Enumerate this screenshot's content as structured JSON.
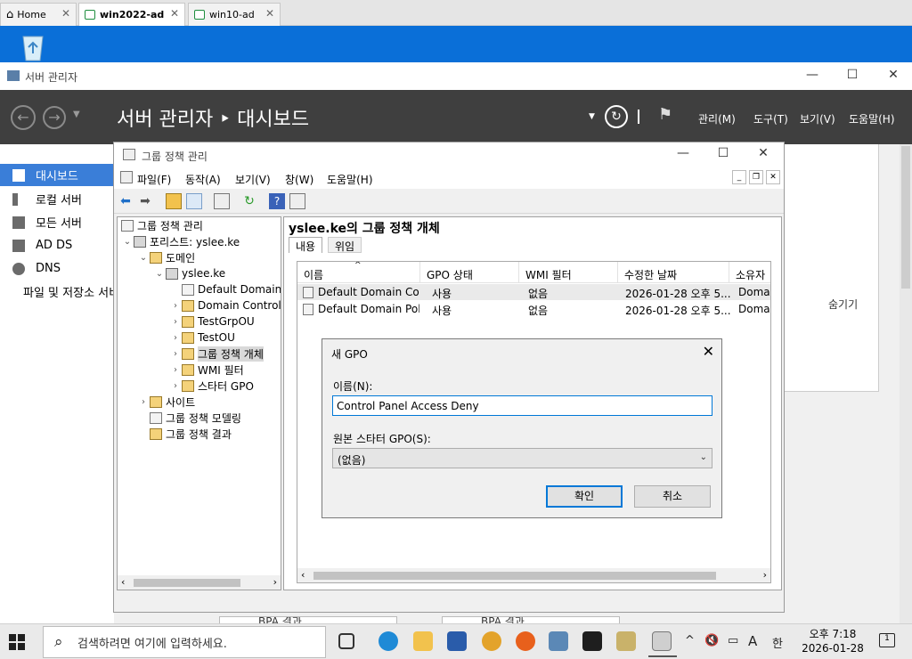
{
  "browser_tabs": [
    {
      "label": "Home"
    },
    {
      "label": "win2022-ad"
    },
    {
      "label": "win10-ad"
    }
  ],
  "server_manager": {
    "window_title": "서버 관리자",
    "breadcrumb": "서버 관리자 ‣ 대시보드",
    "menus": [
      "관리(M)",
      "도구(T)",
      "보기(V)",
      "도움말(H)"
    ],
    "nav": [
      "대시보드",
      "로컬 서버",
      "모든 서버",
      "AD DS",
      "DNS",
      "파일 및 저장소 서비스"
    ],
    "hide_label": "숨기기",
    "bpa": [
      "BPA 결과",
      "BPA 결과"
    ]
  },
  "gpmc": {
    "window_title": "그룹 정책 관리",
    "menus": [
      "파일(F)",
      "동작(A)",
      "보기(V)",
      "창(W)",
      "도움말(H)"
    ],
    "tree": [
      {
        "label": "그룹 정책 관리"
      },
      {
        "label": "포리스트: yslee.ke"
      },
      {
        "label": "도메인"
      },
      {
        "label": "yslee.ke"
      },
      {
        "label": "Default Domain Policy"
      },
      {
        "label": "Domain Controllers"
      },
      {
        "label": "TestGrpOU"
      },
      {
        "label": "TestOU"
      },
      {
        "label": "그룹 정책 개체"
      },
      {
        "label": "WMI 필터"
      },
      {
        "label": "스타터 GPO"
      },
      {
        "label": "사이트"
      },
      {
        "label": "그룹 정책 모델링"
      },
      {
        "label": "그룹 정책 결과"
      }
    ],
    "pane_title": "yslee.ke의 그룹 정책 개체",
    "tabs": [
      "내용",
      "위임"
    ],
    "columns": [
      "이름",
      "GPO 상태",
      "WMI 필터",
      "수정한 날짜",
      "소유자"
    ],
    "rows": [
      [
        "Default Domain Co...",
        "사용",
        "없음",
        "2026-01-28 오후 5...",
        "Domai"
      ],
      [
        "Default Domain Poli...",
        "사용",
        "없음",
        "2026-01-28 오후 5...",
        "Domai"
      ]
    ]
  },
  "new_gpo_dialog": {
    "title": "새 GPO",
    "name_label": "이름(N):",
    "name_value": "Control Panel Access Deny",
    "source_label": "원본 스타터 GPO(S):",
    "source_value": "(없음)",
    "ok_label": "확인",
    "cancel_label": "취소"
  },
  "taskbar": {
    "search_placeholder": "검색하려면 여기에 입력하세요.",
    "ime_lang": "A",
    "ime_mode": "한",
    "time": "오후 7:18",
    "date": "2026-01-28",
    "notification_count": "1"
  }
}
